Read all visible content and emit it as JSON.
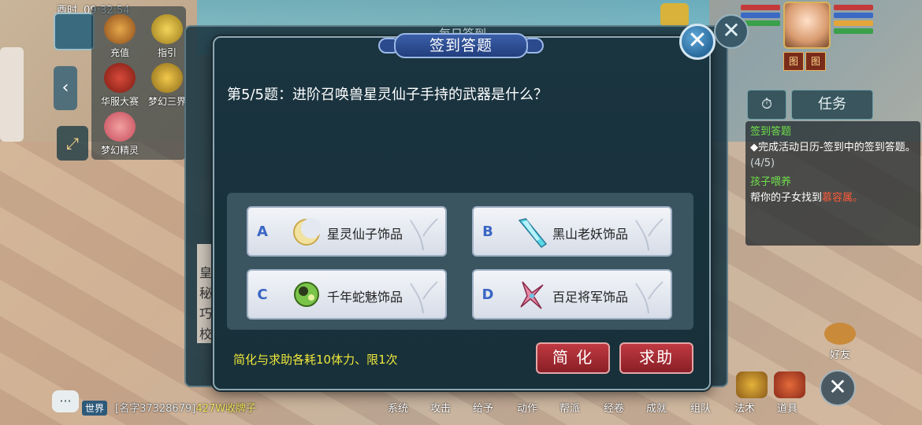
{
  "hud": {
    "clock_label": "酉时",
    "clock_time": "09:32:54"
  },
  "left_menu": {
    "items": [
      {
        "label": "充值",
        "icon": "gift-chest-icon"
      },
      {
        "label": "指引",
        "icon": "guide-scroll-icon"
      },
      {
        "label": "华服大赛",
        "icon": "costume-contest-icon"
      },
      {
        "label": "梦幻三界",
        "icon": "dream-realm-icon"
      },
      {
        "label": "梦幻精灵",
        "icon": "fairy-sprite-icon"
      }
    ]
  },
  "player": {
    "tag_left": "图",
    "tag_right": "图"
  },
  "task_panel": {
    "tab_label": "任务",
    "task1_title": "签到答题",
    "task1_desc": "◆完成活动日历-签到中的签到答题。",
    "task1_progress": "(4/5)",
    "task2_title": "孩子喂养",
    "task2_desc": "帮你的子女找到",
    "task2_target": "慕容属。"
  },
  "background_dialog": {
    "title": "每日签到",
    "side_text": [
      "皇",
      "秘",
      "巧",
      "校"
    ]
  },
  "dialog": {
    "title": "签到答题",
    "question": "第5/5题：进阶召唤兽星灵仙子手持的武器是什么？",
    "answers": [
      {
        "letter": "A",
        "label": "星灵仙子饰品",
        "icon": "crescent-moon-icon"
      },
      {
        "letter": "B",
        "label": "黑山老妖饰品",
        "icon": "crystal-sword-icon"
      },
      {
        "letter": "C",
        "label": "千年蛇魅饰品",
        "icon": "green-orb-icon"
      },
      {
        "letter": "D",
        "label": "百足将军饰品",
        "icon": "pink-blade-icon"
      }
    ],
    "tip": "简化与求助各耗10体力、限1次",
    "simplify_label": "简 化",
    "help_label": "求助"
  },
  "chat": {
    "channel": "世界",
    "name": "[名字37328679]",
    "message": "427W收牌子"
  },
  "bottom_menu": [
    "系统",
    "攻击",
    "给予",
    "动作",
    "帮派",
    "经卷",
    "成就",
    "组队",
    "法术",
    "道具"
  ],
  "friend_label": "好友",
  "colors": {
    "dialog_bg": "#173039",
    "answer_letter": "#3a66c4",
    "tip_yellow": "#f0e83a",
    "button_red": "#a82a32",
    "task_green": "#6fe04a"
  }
}
